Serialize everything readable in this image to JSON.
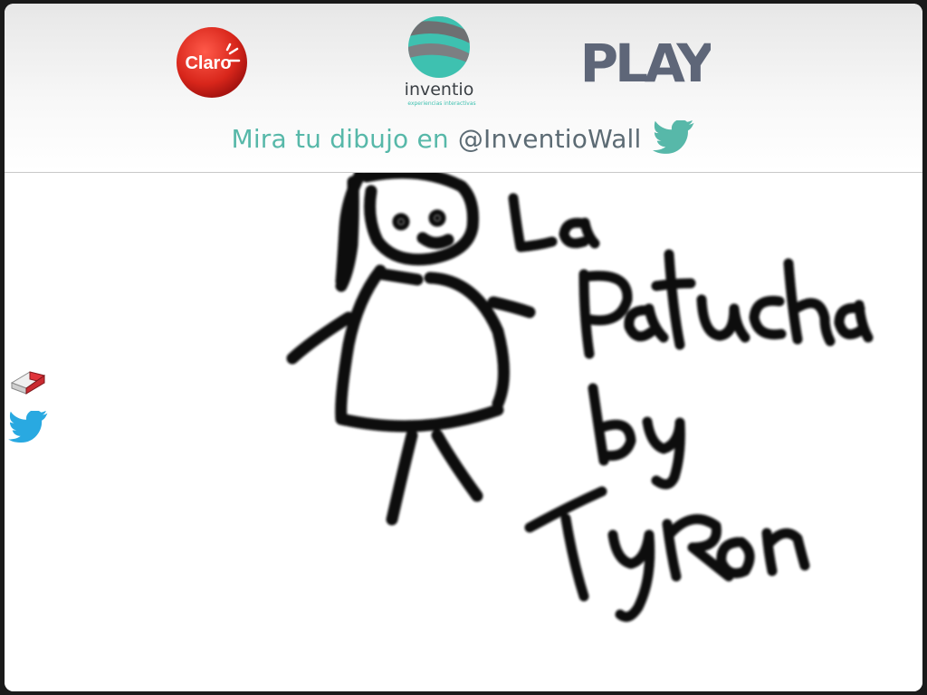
{
  "header": {
    "logos": {
      "claro": {
        "text": "Claro"
      },
      "inventio": {
        "name": "inventio",
        "sub": "experiencias interactivas"
      },
      "play": {
        "text": "PLAY"
      }
    },
    "tagline": {
      "text": "Mira tu dibujo en",
      "handle": "@InventioWall",
      "icon": "twitter-bird-icon"
    }
  },
  "tools": [
    {
      "icon": "eraser-icon"
    },
    {
      "icon": "twitter-bird-icon"
    }
  ],
  "drawing": {
    "text_lines": [
      "La",
      "Patucha",
      "by",
      "Tyron"
    ],
    "stroke_color": "#111111"
  },
  "colors": {
    "claro_red": "#da291c",
    "inventio_teal": "#3ec1b0",
    "tagline_teal": "#57b8a9",
    "handle_gray": "#5c6b74",
    "play_gray": "#5e6678",
    "twitter_blue": "#29a9e1"
  }
}
